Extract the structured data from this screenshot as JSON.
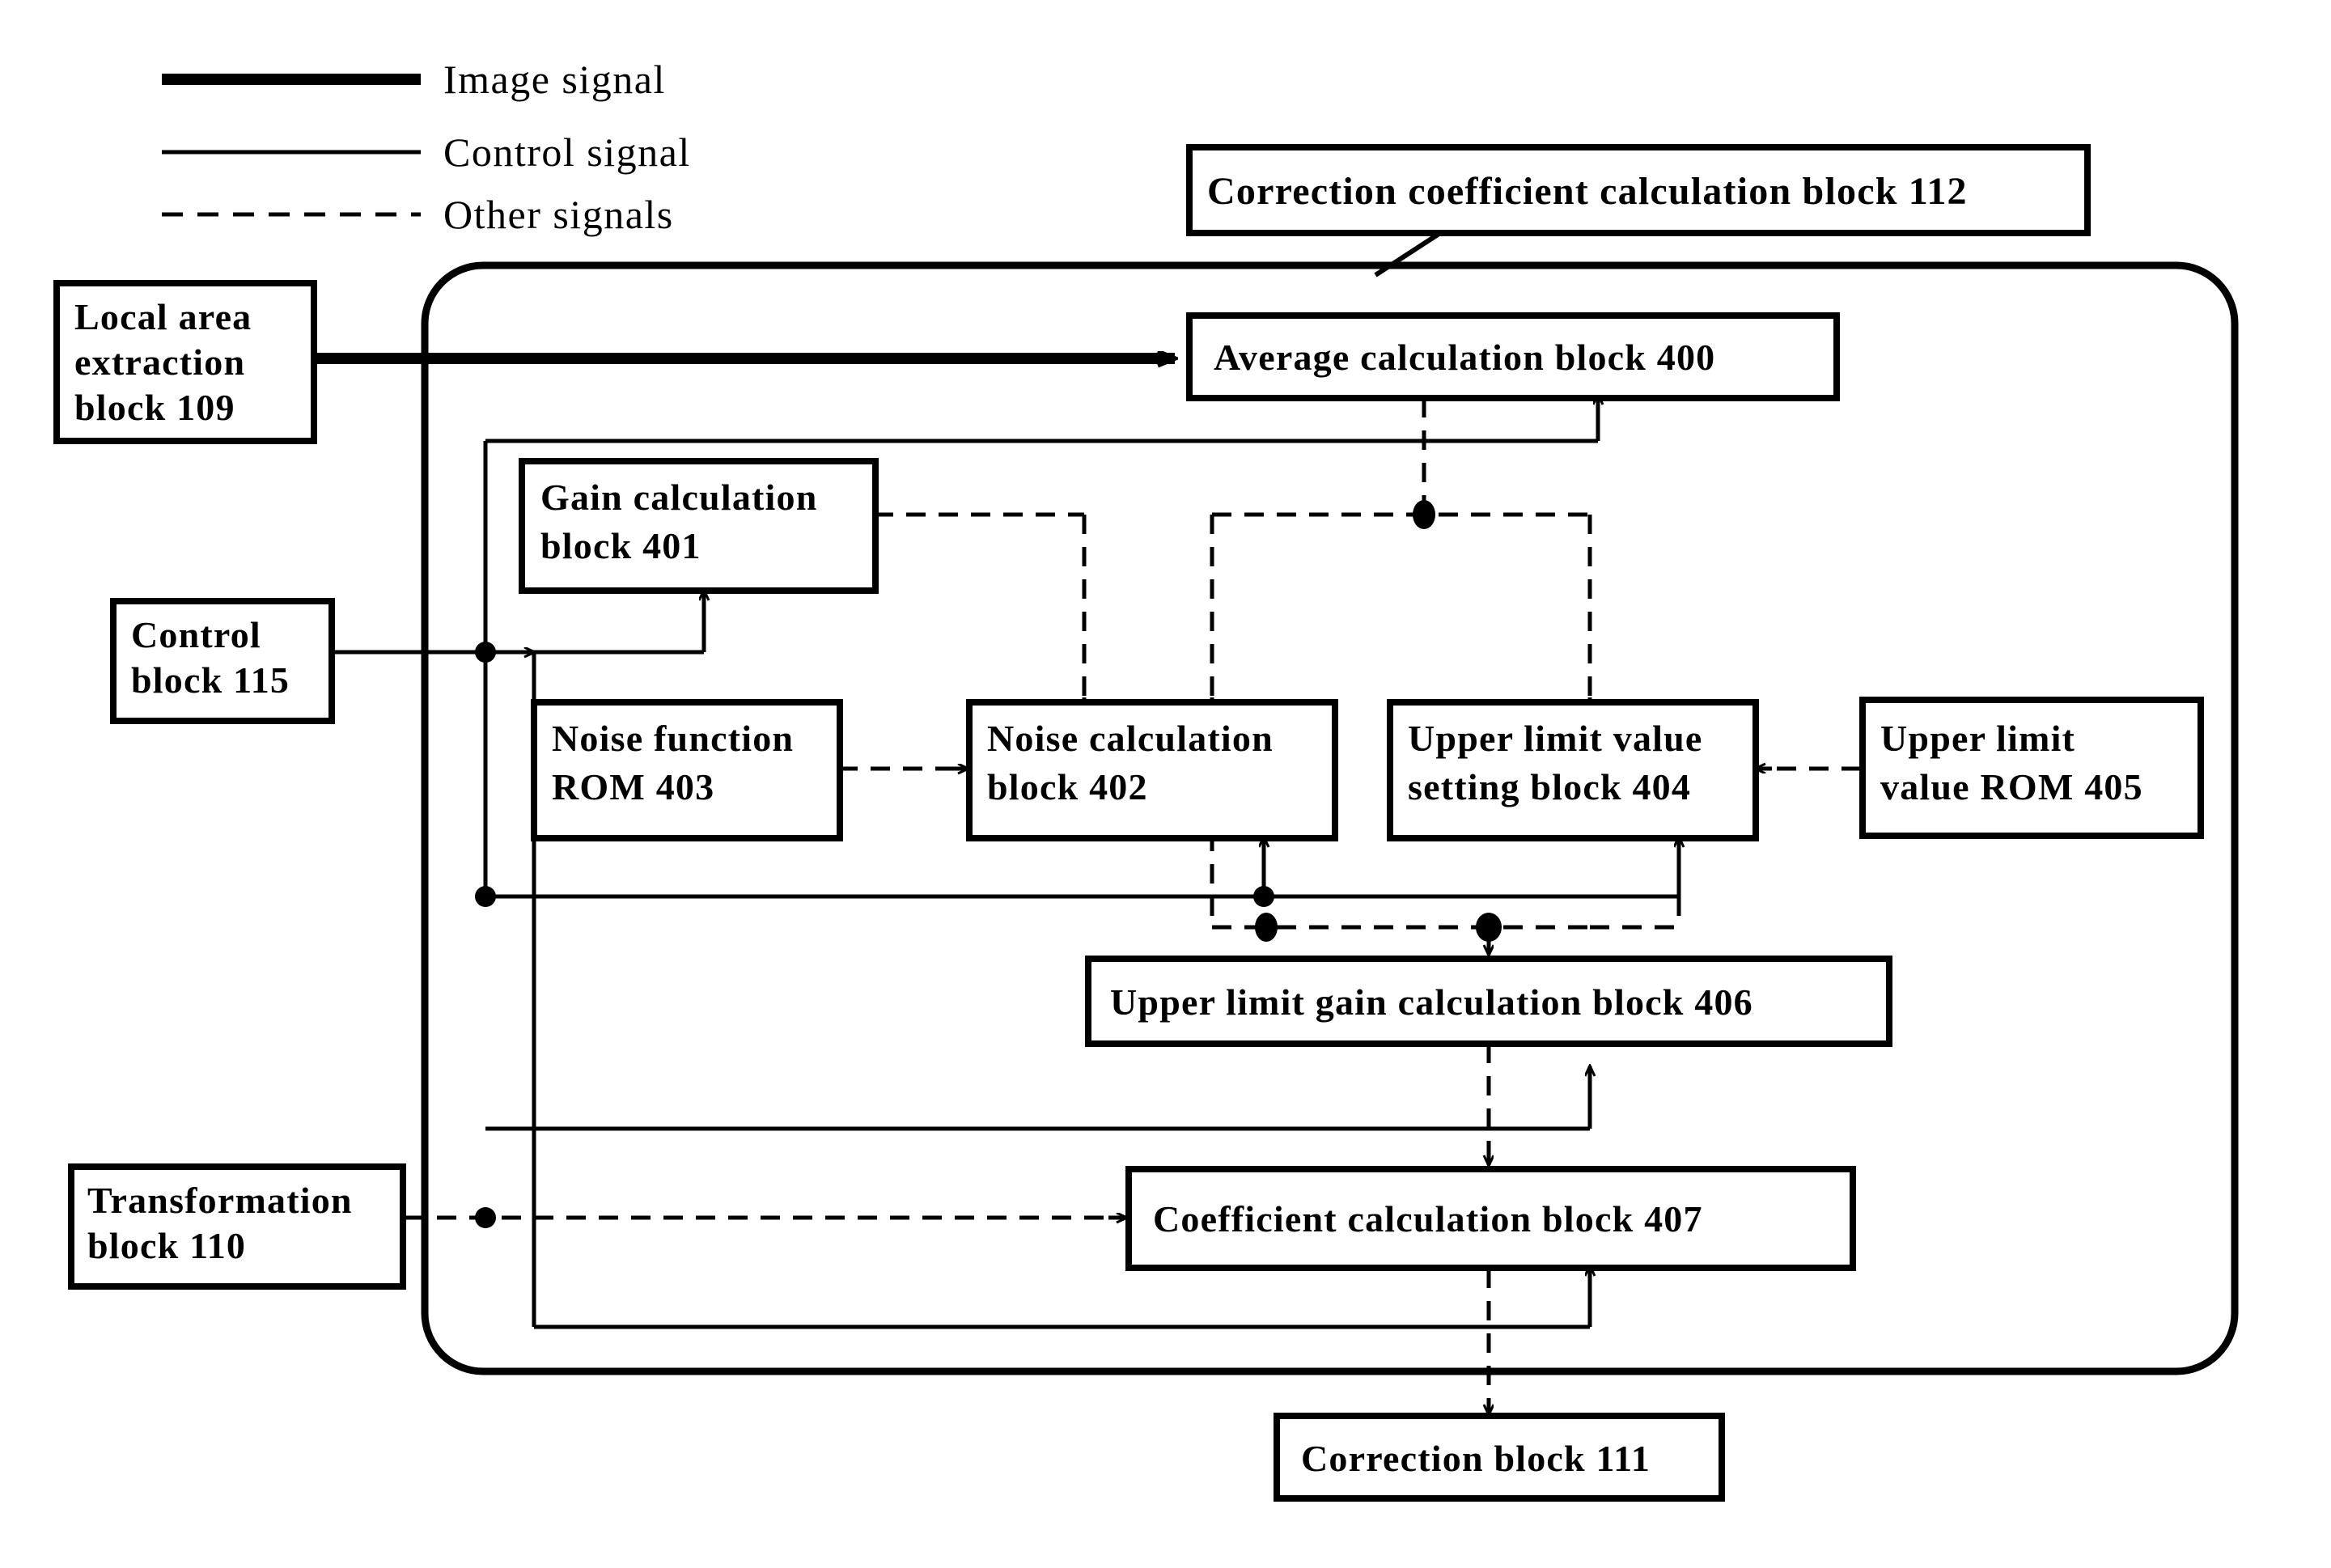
{
  "figure": {
    "kind": "patent-block-diagram",
    "background": "#ffffff",
    "ink": "#000000"
  },
  "legend": {
    "items": [
      {
        "label": "Image signal",
        "style": "thick-solid"
      },
      {
        "label": "Control signal",
        "style": "thin-solid"
      },
      {
        "label": "Other signals",
        "style": "dashed"
      }
    ]
  },
  "title_box": {
    "label": "Correction coefficient calculation block 112"
  },
  "external_blocks": [
    {
      "id": "b109",
      "label_lines": [
        "Local area",
        "extraction",
        "block 109"
      ]
    },
    {
      "id": "b115",
      "label_lines": [
        "Control",
        "block 115"
      ]
    },
    {
      "id": "b110",
      "label_lines": [
        "Transformation",
        "block 110"
      ]
    },
    {
      "id": "b111",
      "label_lines": [
        "Correction block 111"
      ]
    },
    {
      "id": "b405",
      "label_lines": [
        "Upper limit",
        "value ROM 405"
      ]
    }
  ],
  "internal_blocks": [
    {
      "id": "b400",
      "label_lines": [
        "Average calculation block 400"
      ]
    },
    {
      "id": "b401",
      "label_lines": [
        "Gain calculation",
        "block 401"
      ]
    },
    {
      "id": "b403",
      "label_lines": [
        "Noise function",
        "ROM 403"
      ]
    },
    {
      "id": "b402",
      "label_lines": [
        "Noise calculation",
        "block 402"
      ]
    },
    {
      "id": "b404",
      "label_lines": [
        "Upper limit value",
        "setting block 404"
      ]
    },
    {
      "id": "b406",
      "label_lines": [
        "Upper limit gain calculation block 406"
      ]
    },
    {
      "id": "b407",
      "label_lines": [
        "Coefficient calculation block 407"
      ]
    }
  ],
  "connections": [
    {
      "from": "b109",
      "to": "b400",
      "style": "thick-solid",
      "name": "image-signal-to-average"
    },
    {
      "from": "b400",
      "to": "b404",
      "style": "dashed",
      "name": "average-to-upper-limit"
    },
    {
      "from": "b400",
      "to": "b402",
      "style": "dashed",
      "name": "average-to-noise"
    },
    {
      "from": "b401",
      "to": "b402",
      "style": "dashed",
      "name": "gain-to-noise"
    },
    {
      "from": "b403",
      "to": "b402",
      "style": "dashed",
      "name": "noise-rom-to-noise-calc"
    },
    {
      "from": "b405",
      "to": "b404",
      "style": "dashed",
      "name": "upper-rom-to-upper-setting"
    },
    {
      "from": "b402",
      "to": "b406",
      "style": "dashed",
      "name": "noise-to-upper-gain"
    },
    {
      "from": "b404",
      "to": "b406",
      "style": "dashed",
      "name": "upper-setting-to-upper-gain"
    },
    {
      "from": "b406",
      "to": "b407",
      "style": "dashed",
      "name": "upper-gain-to-coefficient"
    },
    {
      "from": "b110",
      "to": "b407",
      "style": "dashed",
      "name": "transformation-to-coefficient"
    },
    {
      "from": "b407",
      "to": "b111",
      "style": "dashed",
      "name": "coefficient-to-correction"
    },
    {
      "from": "b115",
      "to": "b400",
      "style": "thin-solid",
      "name": "control-to-average"
    },
    {
      "from": "b115",
      "to": "b401",
      "style": "thin-solid",
      "name": "control-to-gain"
    },
    {
      "from": "b115",
      "to": "b402",
      "style": "thin-solid",
      "name": "control-to-noise"
    },
    {
      "from": "b115",
      "to": "b404",
      "style": "thin-solid",
      "name": "control-to-upper-setting"
    },
    {
      "from": "b115",
      "to": "b406",
      "style": "thin-solid",
      "name": "control-to-upper-gain"
    },
    {
      "from": "b115",
      "to": "b407",
      "style": "thin-solid",
      "name": "control-to-coefficient"
    }
  ]
}
